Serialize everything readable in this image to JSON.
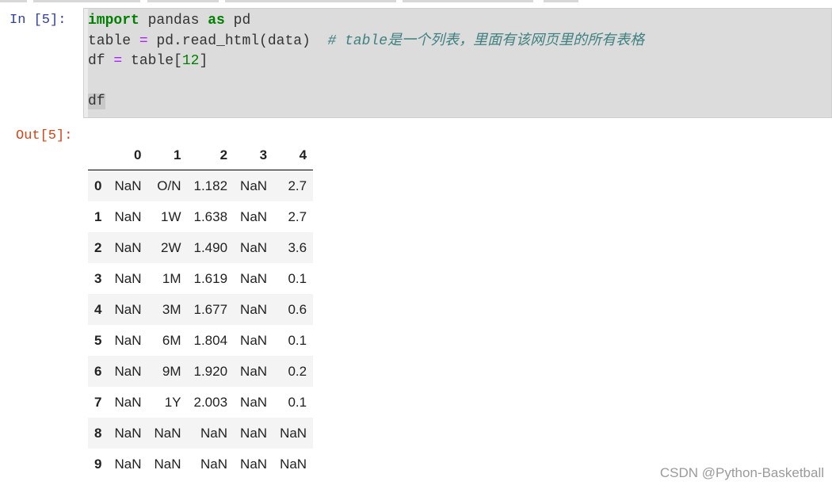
{
  "cell_in": {
    "prompt": "In  [5]:",
    "code": {
      "line1": {
        "kw_import": "import",
        "module": " pandas ",
        "kw_as": "as",
        "alias": " pd"
      },
      "line2": {
        "lhs": "table ",
        "eq": "=",
        "call": " pd.read_html(data)  ",
        "comment": "# table是一个列表，里面有该网页里的所有表格"
      },
      "line3": {
        "lhs": "df ",
        "eq": "=",
        "pre": " table[",
        "index": "12",
        "post": "]"
      },
      "line5": "df"
    }
  },
  "cell_out": {
    "prompt": "Out[5]:",
    "columns": [
      "",
      "0",
      "1",
      "2",
      "3",
      "4"
    ],
    "rows": [
      {
        "index": "0",
        "values": [
          "NaN",
          "O/N",
          "1.182",
          "NaN",
          "2.7"
        ]
      },
      {
        "index": "1",
        "values": [
          "NaN",
          "1W",
          "1.638",
          "NaN",
          "2.7"
        ]
      },
      {
        "index": "2",
        "values": [
          "NaN",
          "2W",
          "1.490",
          "NaN",
          "3.6"
        ]
      },
      {
        "index": "3",
        "values": [
          "NaN",
          "1M",
          "1.619",
          "NaN",
          "0.1"
        ]
      },
      {
        "index": "4",
        "values": [
          "NaN",
          "3M",
          "1.677",
          "NaN",
          "0.6"
        ]
      },
      {
        "index": "5",
        "values": [
          "NaN",
          "6M",
          "1.804",
          "NaN",
          "0.1"
        ]
      },
      {
        "index": "6",
        "values": [
          "NaN",
          "9M",
          "1.920",
          "NaN",
          "0.2"
        ]
      },
      {
        "index": "7",
        "values": [
          "NaN",
          "1Y",
          "2.003",
          "NaN",
          "0.1"
        ]
      },
      {
        "index": "8",
        "values": [
          "NaN",
          "NaN",
          "NaN",
          "NaN",
          "NaN"
        ]
      },
      {
        "index": "9",
        "values": [
          "NaN",
          "NaN",
          "NaN",
          "NaN",
          "NaN"
        ]
      }
    ]
  },
  "watermark": "CSDN @Python-Basketball",
  "colors": {
    "in_prompt": "#303f9f",
    "out_prompt": "#d84315",
    "keyword": "#008000",
    "operator": "#aa22ff",
    "comment": "#408080"
  }
}
